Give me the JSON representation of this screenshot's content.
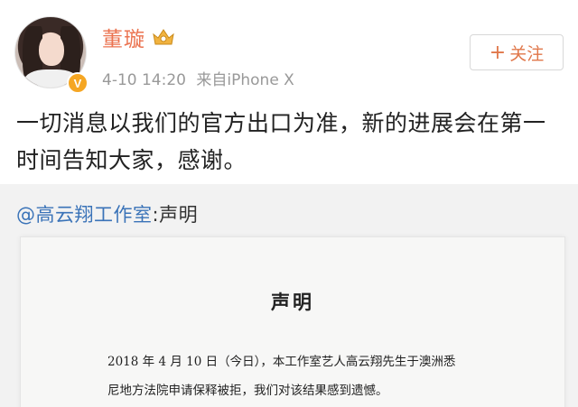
{
  "post": {
    "username": "董璇",
    "time": "4-10 14:20",
    "source": "来自iPhone X",
    "follow_label": "关注",
    "text": "一切消息以我们的官方出口为准，新的进展会在第一时间告知大家，感谢。",
    "badges": {
      "verified": "V",
      "verified_color": "#f5a623",
      "crown_color": "#f1b340"
    }
  },
  "repost": {
    "mention": "@高云翔工作室",
    "suffix": ":声明",
    "document": {
      "title": "声明",
      "body_line1": "2018 年 4 月 10 日（今日），本工作室艺人高云翔先生于澳洲悉",
      "body_line2": "尼地方法院申请保释被拒，我们对该结果感到遗憾。"
    }
  },
  "colors": {
    "username": "#eb7350",
    "link": "#3a73b8",
    "follow_text": "#e0774a",
    "repost_bg": "#f2f2f2"
  }
}
